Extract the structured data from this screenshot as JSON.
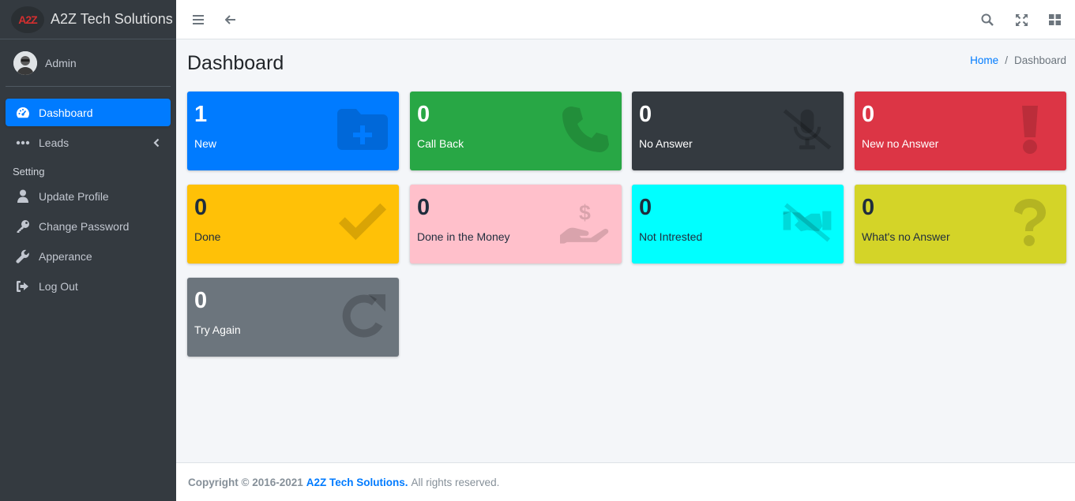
{
  "brand": {
    "logo_text": "A2Z",
    "name": "A2Z Tech Solutions"
  },
  "user": {
    "name": "Admin"
  },
  "sidebar": {
    "items": [
      {
        "label": "Dashboard",
        "icon": "tachometer-icon"
      },
      {
        "label": "Leads",
        "icon": "ellipsis-icon"
      }
    ],
    "section_header": "Setting",
    "settings": [
      {
        "label": "Update Profile",
        "icon": "user-icon"
      },
      {
        "label": "Change Password",
        "icon": "key-icon"
      },
      {
        "label": "Apperance",
        "icon": "wrench-icon"
      },
      {
        "label": "Log Out",
        "icon": "sign-out-icon"
      }
    ]
  },
  "topbar": {
    "icons": [
      "menu-icon",
      "back-arrow-icon",
      "search-icon",
      "fullscreen-icon",
      "grid-icon"
    ]
  },
  "page": {
    "title": "Dashboard"
  },
  "breadcrumb": {
    "home": "Home",
    "current": "Dashboard"
  },
  "cards": [
    {
      "count": "1",
      "label": "New",
      "icon": "folder-plus-icon",
      "bg": "#007bff"
    },
    {
      "count": "0",
      "label": "Call Back",
      "icon": "phone-icon",
      "bg": "#28a745"
    },
    {
      "count": "0",
      "label": "No Answer",
      "icon": "microphone-slash-icon",
      "bg": "#343a40"
    },
    {
      "count": "0",
      "label": "New no Answer",
      "icon": "exclamation-icon",
      "bg": "#dc3545"
    },
    {
      "count": "0",
      "label": "Done",
      "icon": "check-icon",
      "bg": "#ffc107"
    },
    {
      "count": "0",
      "label": "Done in the Money",
      "icon": "hand-holding-usd-icon",
      "bg": "#ffc0cb"
    },
    {
      "count": "0",
      "label": "Not Intrested",
      "icon": "handshake-slash-icon",
      "bg": "#00ffff"
    },
    {
      "count": "0",
      "label": "What's no Answer",
      "icon": "question-icon",
      "bg": "#d4d428"
    },
    {
      "count": "0",
      "label": "Try Again",
      "icon": "redo-icon",
      "bg": "#6c757d"
    }
  ],
  "footer": {
    "copyright": "Copyright © 2016-2021",
    "company": "A2Z Tech Solutions.",
    "rights": "All rights reserved."
  }
}
